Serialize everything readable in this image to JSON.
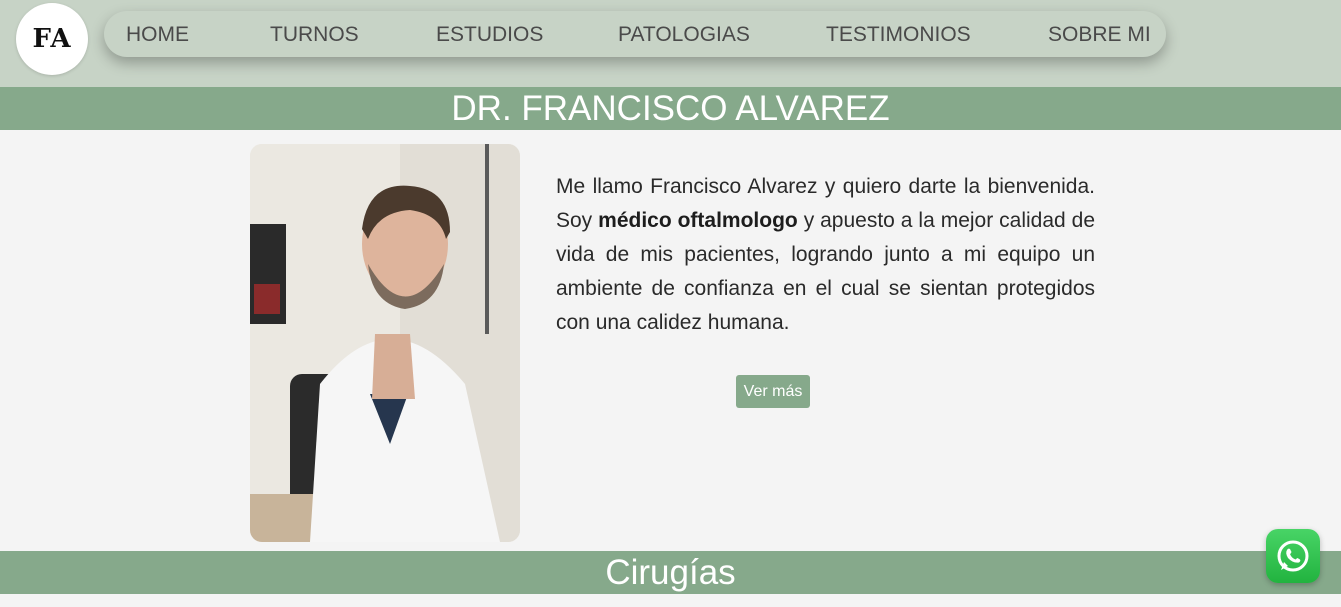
{
  "logo": {
    "text": "FA"
  },
  "nav": {
    "items": [
      {
        "label": "HOME"
      },
      {
        "label": "TURNOS"
      },
      {
        "label": "ESTUDIOS"
      },
      {
        "label": "PATOLOGIAS"
      },
      {
        "label": "TESTIMONIOS"
      },
      {
        "label": "SOBRE MI"
      }
    ]
  },
  "hero": {
    "title": "DR. FRANCISCO ALVAREZ",
    "bio_part1": "Me llamo Francisco Alvarez y quiero darte la bienvenida. Soy ",
    "bio_bold": "médico oftalmologo",
    "bio_part2": " y apuesto a la mejor calidad de vida de mis pacientes, logrando junto a mi equipo un ambiente de confianza en el cual se sientan protegidos con una calidez humana.",
    "button_label": "Ver más"
  },
  "section": {
    "title": "Cirugías"
  },
  "icons": {
    "whatsapp": "whatsapp-icon"
  },
  "colors": {
    "header_bg": "#c7d3c6",
    "accent_green": "#86a98b",
    "page_bg": "#f4f4f4",
    "whatsapp_green": "#25d366"
  }
}
